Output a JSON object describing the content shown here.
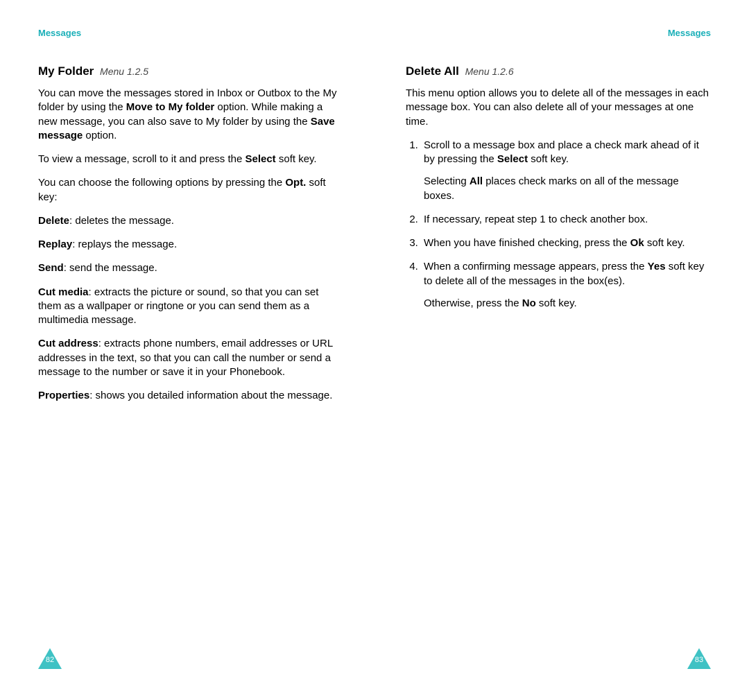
{
  "header": "Messages",
  "left": {
    "pageNumber": "82",
    "heading": "My Folder",
    "menu": "Menu 1.2.5",
    "p1a": "You can move the messages stored in Inbox or Outbox to the My folder by using the ",
    "p1b": "Move to My folder",
    "p1c": " option. While making a new message, you can also save to My folder by using the ",
    "p1d": "Save message",
    "p1e": " option.",
    "p2a": "To view a message, scroll to it and press the ",
    "p2b": "Select",
    "p2c": " soft key.",
    "p3a": "You can choose the following options by pressing the ",
    "p3b": "Opt.",
    "p3c": " soft key:",
    "opt1b": "Delete",
    "opt1t": ": deletes the message.",
    "opt2b": "Replay",
    "opt2t": ": replays the message.",
    "opt3b": "Send",
    "opt3t": ": send the message.",
    "opt4b": "Cut media",
    "opt4t": ": extracts the picture or sound, so that you can set them as a wallpaper or ringtone or you can send them as a multimedia message.",
    "opt5b": "Cut address",
    "opt5t": ": extracts phone numbers, email addresses or URL addresses in the text, so that you can call the number or send a message to the number or save it in your Phonebook.",
    "opt6b": "Properties",
    "opt6t": ": shows you detailed information about the message."
  },
  "right": {
    "pageNumber": "83",
    "heading": "Delete All",
    "menu": "Menu 1.2.6",
    "intro": "This menu option allows you to delete all of the messages in each message box. You can also delete all of your messages at one time.",
    "s1a": "Scroll to a message box and place a check mark ahead of it by pressing the ",
    "s1b": "Select",
    "s1c": " soft key.",
    "s1pa": "Selecting ",
    "s1pb": "All",
    "s1pc": " places check marks on all of the message boxes.",
    "s2": "If necessary, repeat step 1 to check another box.",
    "s3a": "When you have finished checking, press the ",
    "s3b": "Ok",
    "s3c": " soft key.",
    "s4a": "When a confirming message appears, press the ",
    "s4b": "Yes",
    "s4c": " soft key to delete all of the messages in the box(es).",
    "s4pa": "Otherwise, press the ",
    "s4pb": "No",
    "s4pc": " soft key."
  }
}
